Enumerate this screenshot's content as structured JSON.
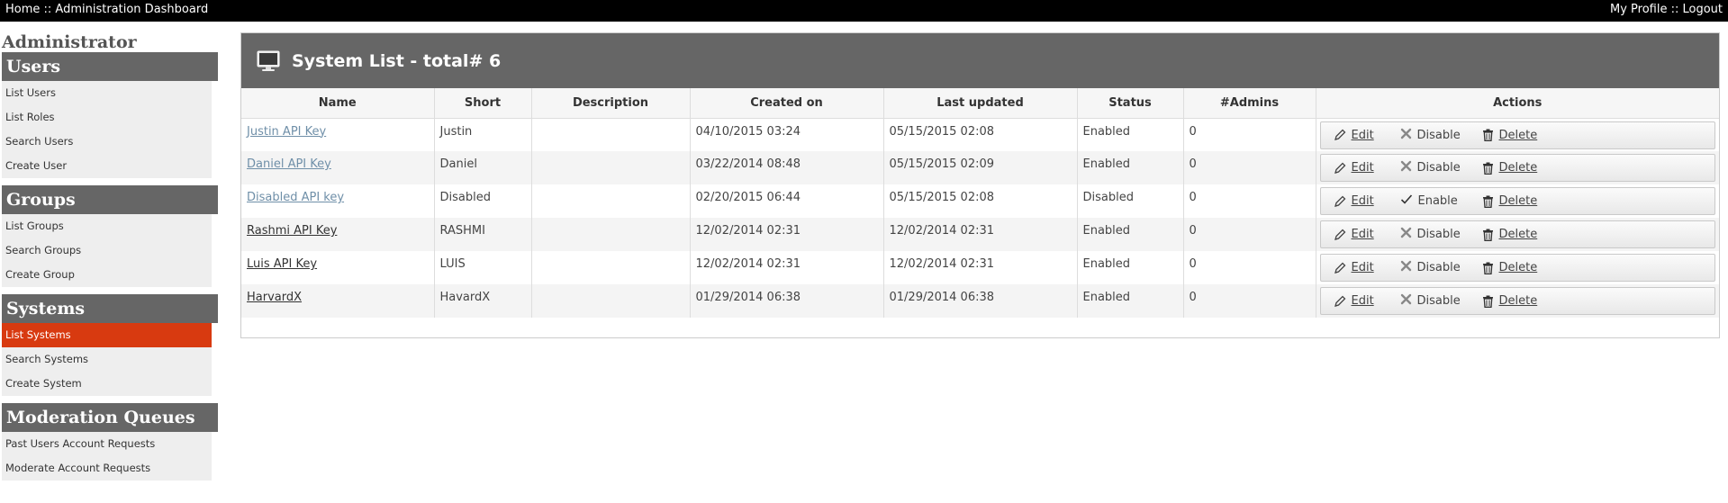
{
  "topbar": {
    "home": "Home",
    "sep": " :: ",
    "dashboard": "Administration Dashboard",
    "profile": "My Profile",
    "logout": "Logout"
  },
  "sidebar": {
    "title": "Administrator",
    "sections": [
      {
        "title": "Users",
        "items": [
          "List Users",
          "List Roles",
          "Search Users",
          "Create User"
        ]
      },
      {
        "title": "Groups",
        "items": [
          "List Groups",
          "Search Groups",
          "Create Group"
        ]
      },
      {
        "title": "Systems",
        "items": [
          "List Systems",
          "Search Systems",
          "Create System"
        ]
      },
      {
        "title": "Moderation Queues",
        "items": [
          "Past Users Account Requests",
          "Moderate Account Requests"
        ]
      }
    ],
    "active_item": "List Systems"
  },
  "panel": {
    "title": "System List - total# 6",
    "columns": [
      "Name",
      "Short",
      "Description",
      "Created on",
      "Last updated",
      "Status",
      "#Admins",
      "Actions"
    ],
    "rows": [
      {
        "name": "Justin API Key",
        "short": "Justin",
        "description": "",
        "created": "04/10/2015 03:24",
        "updated": "05/15/2015 02:08",
        "status": "Enabled",
        "admins": "0",
        "edit": "Edit",
        "toggle": "Disable",
        "delete": "Delete",
        "visited": true
      },
      {
        "name": "Daniel API Key",
        "short": "Daniel",
        "description": "",
        "created": "03/22/2014 08:48",
        "updated": "05/15/2015 02:09",
        "status": "Enabled",
        "admins": "0",
        "edit": "Edit",
        "toggle": "Disable",
        "delete": "Delete",
        "visited": true
      },
      {
        "name": "Disabled API key",
        "short": "Disabled",
        "description": "",
        "created": "02/20/2015 06:44",
        "updated": "05/15/2015 02:08",
        "status": "Disabled",
        "admins": "0",
        "edit": "Edit",
        "toggle": "Enable",
        "delete": "Delete",
        "visited": true
      },
      {
        "name": "Rashmi API Key",
        "short": "RASHMI",
        "description": "",
        "created": "12/02/2014 02:31",
        "updated": "12/02/2014 02:31",
        "status": "Enabled",
        "admins": "0",
        "edit": "Edit",
        "toggle": "Disable",
        "delete": "Delete",
        "visited": false
      },
      {
        "name": "Luis API Key",
        "short": "LUIS",
        "description": "",
        "created": "12/02/2014 02:31",
        "updated": "12/02/2014 02:31",
        "status": "Enabled",
        "admins": "0",
        "edit": "Edit",
        "toggle": "Disable",
        "delete": "Delete",
        "visited": false
      },
      {
        "name": "HarvardX",
        "short": "HavardX",
        "description": "",
        "created": "01/29/2014 06:38",
        "updated": "01/29/2014 06:38",
        "status": "Enabled",
        "admins": "0",
        "edit": "Edit",
        "toggle": "Disable",
        "delete": "Delete",
        "visited": false
      }
    ]
  },
  "icons": {
    "monitor": "monitor-icon",
    "edit": "pencil-icon",
    "disable": "x-icon",
    "enable": "checkmark-icon",
    "delete": "trash-icon"
  },
  "colors": {
    "active_nav": "#d83a10",
    "header_gray": "#666666",
    "visited_link": "#6f8fa8"
  }
}
